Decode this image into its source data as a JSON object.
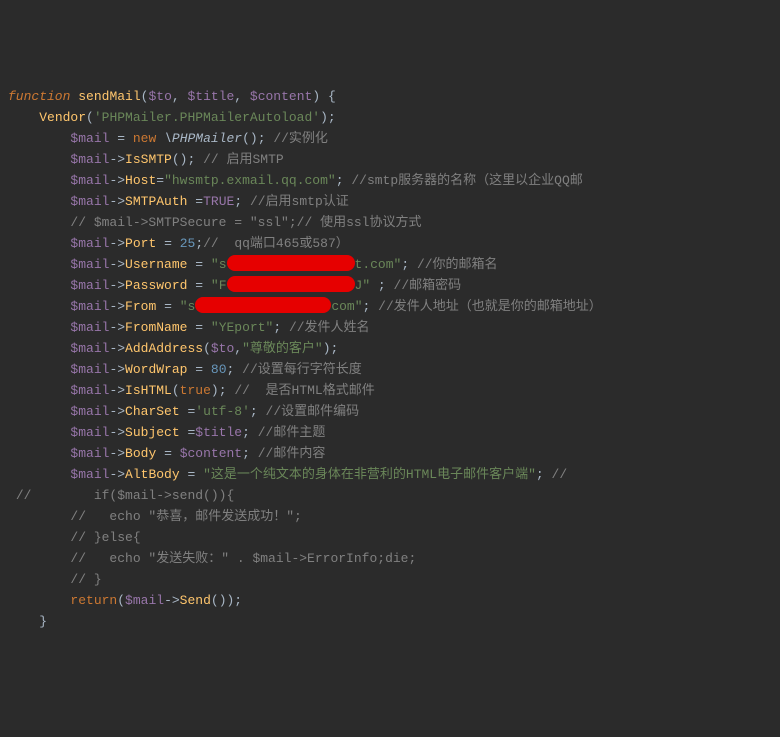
{
  "code": {
    "l1": {
      "kw": "function",
      "fn": "sendMail",
      "p1": "$to",
      "p2": "$title",
      "p3": "$content",
      "brace": "{"
    },
    "l2": {
      "fn": "Vendor",
      "str": "'PHPMailer.PHPMailerAutoload'"
    },
    "l3": {
      "var": "$mail",
      "eq": "=",
      "kw": "new",
      "cls": "\\PHPMailer",
      "cmt": "//实例化"
    },
    "l4": {
      "var": "$mail",
      "arrow": "->",
      "m": "IsSMTP",
      "cmt": "// 启用SMTP"
    },
    "l5": {
      "var": "$mail",
      "arrow": "->",
      "prop": "Host",
      "eq": "=",
      "str": "\"hwsmtp.exmail.qq.com\"",
      "cmt": "//smtp服务器的名称（这里以企业QQ邮"
    },
    "l6": {
      "var": "$mail",
      "arrow": "->",
      "prop": "SMTPAuth",
      "eq": "=",
      "val": "TRUE",
      "cmt": "//启用smtp认证"
    },
    "l7": {
      "cmt": "// $mail->SMTPSecure = \"ssl\";// 使用ssl协议方式"
    },
    "l8": {
      "var": "$mail",
      "arrow": "->",
      "prop": "Port",
      "eq": "=",
      "num": "25",
      "cmt": "//  qq端口465或587）"
    },
    "l9": {
      "var": "$mail",
      "arrow": "->",
      "prop": "Username",
      "eq": "=",
      "q1": "\"s",
      "q2": "t.com\"",
      "cmt": "//你的邮箱名"
    },
    "l10": {
      "var": "$mail",
      "arrow": "->",
      "prop": "Password",
      "eq": "=",
      "q1": "\"F",
      "q2": "J\" ",
      "cmt": "//邮箱密码"
    },
    "l11": {
      "var": "$mail",
      "arrow": "->",
      "prop": "From",
      "eq": "=",
      "q1": "\"s",
      "q2": "com\"",
      "cmt": "//发件人地址（也就是你的邮箱地址）"
    },
    "l12": {
      "var": "$mail",
      "arrow": "->",
      "prop": "FromName",
      "eq": "=",
      "str": "\"YEport\"",
      "cmt": "//发件人姓名"
    },
    "l13": {
      "var": "$mail",
      "arrow": "->",
      "m": "AddAddress",
      "p1": "$to",
      "str": "\"尊敬的客户\""
    },
    "l14": {
      "var": "$mail",
      "arrow": "->",
      "prop": "WordWrap",
      "eq": "=",
      "num": "80",
      "cmt": "//设置每行字符长度"
    },
    "l15": {
      "var": "$mail",
      "arrow": "->",
      "m": "IsHTML",
      "val": "true",
      "cmt": "//  是否HTML格式邮件"
    },
    "l16": {
      "var": "$mail",
      "arrow": "->",
      "prop": "CharSet",
      "eq": "=",
      "str": "'utf-8'",
      "cmt": "//设置邮件编码"
    },
    "l17": {
      "var": "$mail",
      "arrow": "->",
      "prop": "Subject",
      "eq": "=",
      "p": "$title",
      "cmt": "//邮件主题"
    },
    "l18": {
      "var": "$mail",
      "arrow": "->",
      "prop": "Body",
      "eq": "=",
      "p": "$content",
      "cmt": "//邮件内容"
    },
    "l19": {
      "var": "$mail",
      "arrow": "->",
      "prop": "AltBody",
      "eq": "=",
      "str": "\"这是一个纯文本的身体在非营利的HTML电子邮件客户端\"",
      "cmt": "//"
    },
    "l20": {
      "cmt": "//        if($mail->send()){"
    },
    "l21": {
      "cmt": "//   echo \"恭喜，邮件发送成功！\";"
    },
    "l22": {
      "cmt": "// }else{"
    },
    "l23": {
      "cmt": "//   echo \"发送失败：\" . $mail->ErrorInfo;die;"
    },
    "l24": {
      "cmt": "// }"
    },
    "l25": {
      "kw": "return",
      "var": "$mail",
      "arrow": "->",
      "m": "Send"
    },
    "l26": {
      "brace": "}"
    }
  }
}
